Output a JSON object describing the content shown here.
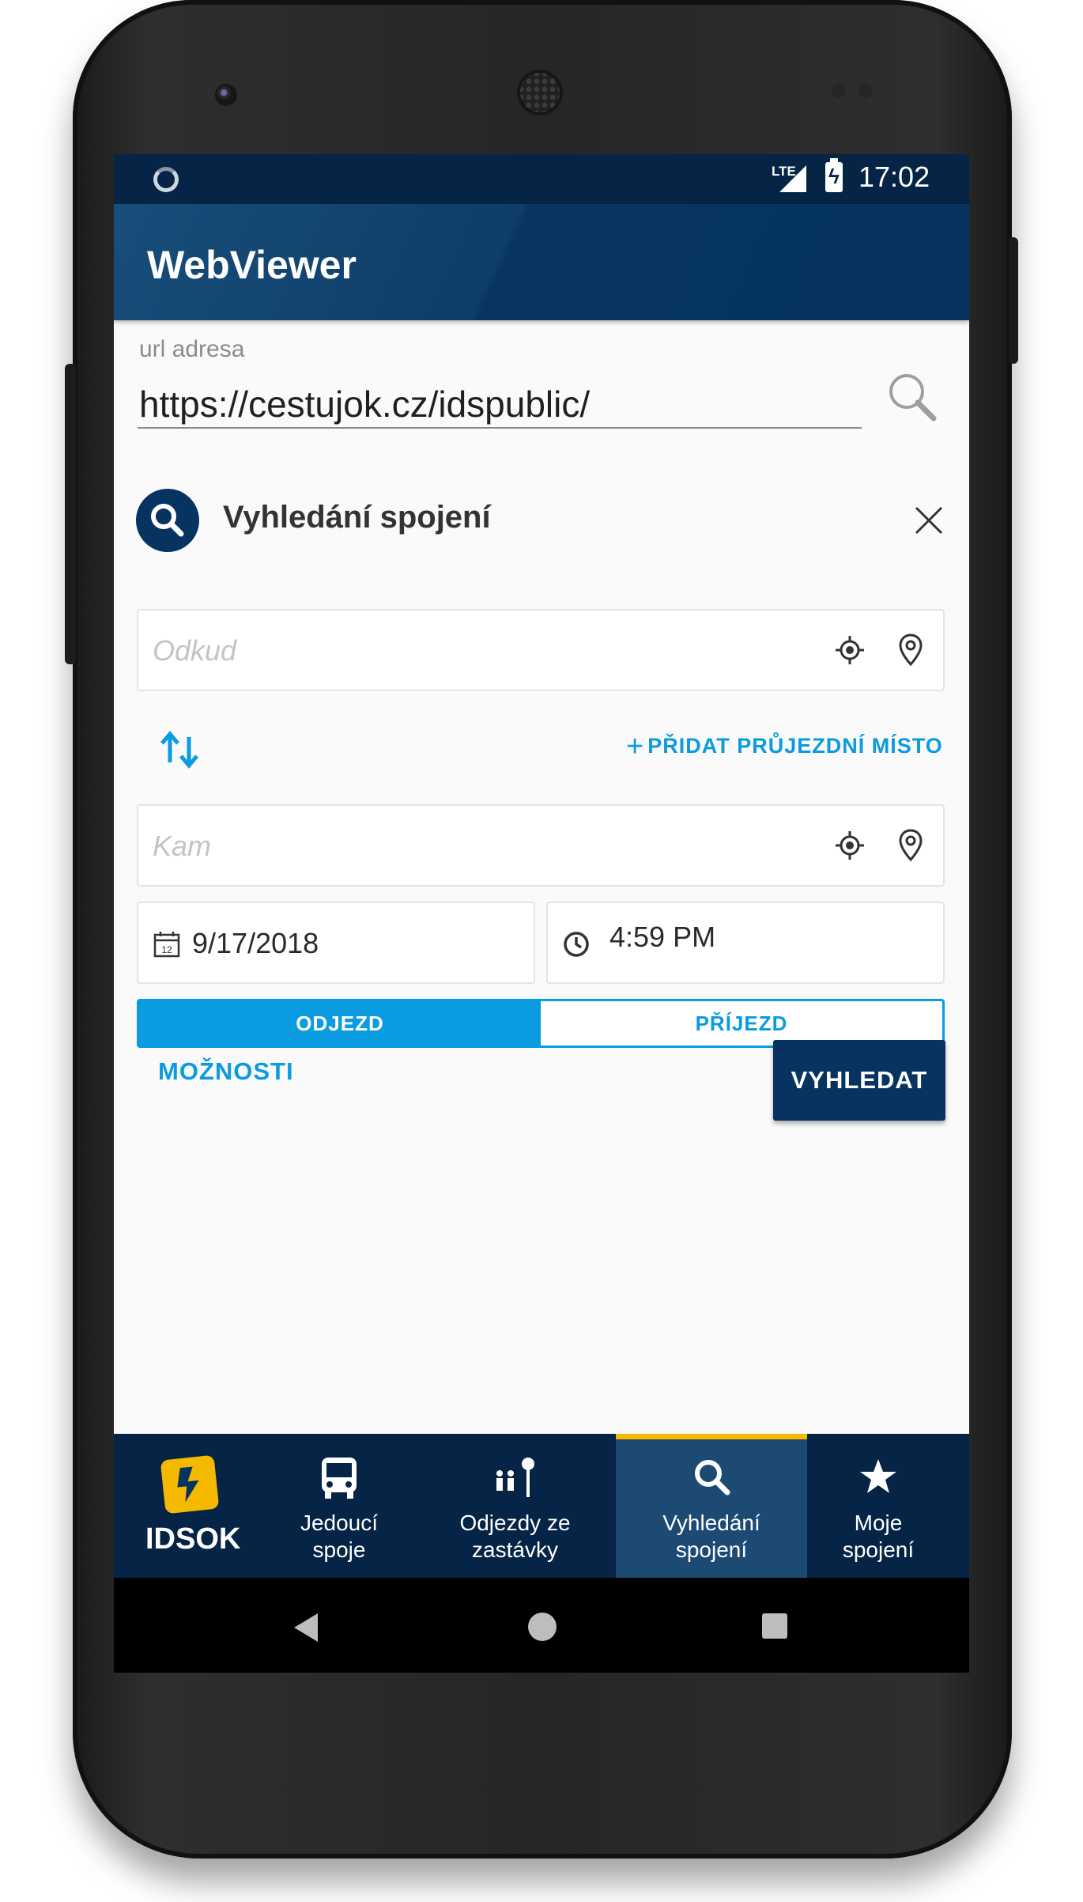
{
  "statusbar": {
    "network": "LTE",
    "time": "17:02"
  },
  "appbar": {
    "title": "WebViewer"
  },
  "url": {
    "label": "url adresa",
    "value": "https://cestujok.cz/idspublic/"
  },
  "search_panel": {
    "title": "Vyhledání spojení",
    "from_placeholder": "Odkud",
    "to_placeholder": "Kam",
    "add_via": "PŘIDAT PRŮJEZDNÍ MÍSTO",
    "date": "9/17/2018",
    "date_icon_day": "12",
    "time": "4:59 PM",
    "departure": "ODJEZD",
    "arrival": "PŘÍJEZD",
    "options": "MOŽNOSTI",
    "search_button": "VYHLEDAT"
  },
  "bottom_nav": {
    "brand": "IDSOK",
    "items": [
      {
        "label": "Jedoucí spoje",
        "icon": "bus-icon"
      },
      {
        "label": "Odjezdy ze zastávky",
        "icon": "bus-stop-icon"
      },
      {
        "label": "Vyhledání spojení",
        "icon": "search-icon"
      },
      {
        "label": "Moje spojení",
        "icon": "star-icon"
      }
    ]
  },
  "colors": {
    "primary": "#063360",
    "accent": "#0a9be0",
    "highlight": "#f5b900"
  }
}
